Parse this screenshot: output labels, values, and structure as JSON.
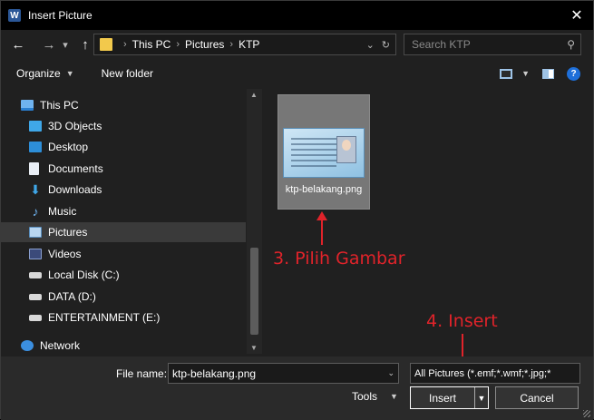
{
  "window": {
    "title": "Insert Picture",
    "app_icon_letter": "W"
  },
  "nav": {
    "back_icon": "←",
    "forward_icon": "→",
    "history_icon": "▾",
    "up_icon": "↑",
    "breadcrumb": [
      "This PC",
      "Pictures",
      "KTP"
    ],
    "search_placeholder": "Search KTP"
  },
  "toolbar": {
    "organize_label": "Organize",
    "new_folder_label": "New folder"
  },
  "sidebar": {
    "items": [
      {
        "label": "This PC",
        "icon": "pc-icon"
      },
      {
        "label": "3D Objects",
        "icon": "cube-icon"
      },
      {
        "label": "Desktop",
        "icon": "desktop-icon"
      },
      {
        "label": "Documents",
        "icon": "documents-icon"
      },
      {
        "label": "Downloads",
        "icon": "download-icon"
      },
      {
        "label": "Music",
        "icon": "music-icon"
      },
      {
        "label": "Pictures",
        "icon": "pictures-icon"
      },
      {
        "label": "Videos",
        "icon": "videos-icon"
      },
      {
        "label": "Local Disk (C:)",
        "icon": "drive-icon"
      },
      {
        "label": "DATA (D:)",
        "icon": "drive-icon"
      },
      {
        "label": "ENTERTAINMENT (E:)",
        "icon": "drive-icon"
      },
      {
        "label": "Network",
        "icon": "network-icon"
      }
    ],
    "selected": "Pictures"
  },
  "files": [
    {
      "name": "ktp-belakang.png",
      "thumbnail": "id-card-thumbnail"
    }
  ],
  "annotations": {
    "step3": "3. Pilih Gambar",
    "step4": "4. Insert",
    "color": "#e0232a"
  },
  "bottom": {
    "file_name_label": "File name:",
    "file_name_value": "ktp-belakang.png",
    "file_type_value": "All Pictures (*.emf;*.wmf;*.jpg;*",
    "tools_label": "Tools",
    "insert_label": "Insert",
    "cancel_label": "Cancel"
  }
}
